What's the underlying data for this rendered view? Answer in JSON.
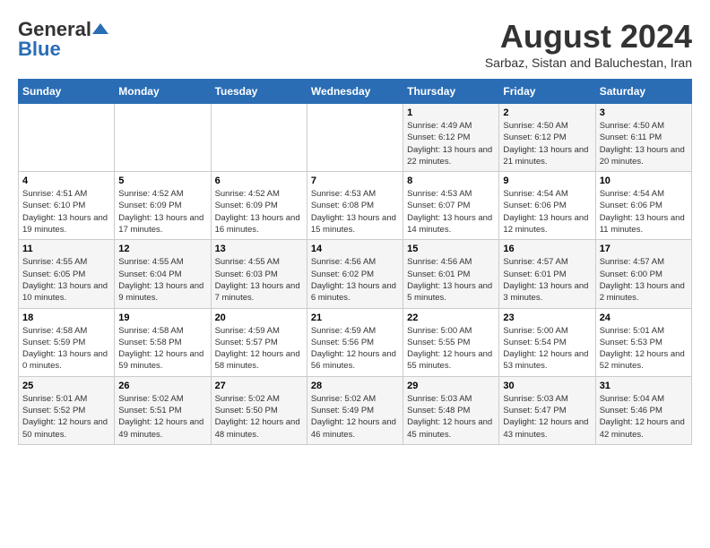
{
  "logo": {
    "general": "General",
    "blue": "Blue"
  },
  "header": {
    "month_year": "August 2024",
    "location": "Sarbaz, Sistan and Baluchestan, Iran"
  },
  "days_of_week": [
    "Sunday",
    "Monday",
    "Tuesday",
    "Wednesday",
    "Thursday",
    "Friday",
    "Saturday"
  ],
  "weeks": [
    [
      {
        "day": "",
        "info": ""
      },
      {
        "day": "",
        "info": ""
      },
      {
        "day": "",
        "info": ""
      },
      {
        "day": "",
        "info": ""
      },
      {
        "day": "1",
        "info": "Sunrise: 4:49 AM\nSunset: 6:12 PM\nDaylight: 13 hours and 22 minutes."
      },
      {
        "day": "2",
        "info": "Sunrise: 4:50 AM\nSunset: 6:12 PM\nDaylight: 13 hours and 21 minutes."
      },
      {
        "day": "3",
        "info": "Sunrise: 4:50 AM\nSunset: 6:11 PM\nDaylight: 13 hours and 20 minutes."
      }
    ],
    [
      {
        "day": "4",
        "info": "Sunrise: 4:51 AM\nSunset: 6:10 PM\nDaylight: 13 hours and 19 minutes."
      },
      {
        "day": "5",
        "info": "Sunrise: 4:52 AM\nSunset: 6:09 PM\nDaylight: 13 hours and 17 minutes."
      },
      {
        "day": "6",
        "info": "Sunrise: 4:52 AM\nSunset: 6:09 PM\nDaylight: 13 hours and 16 minutes."
      },
      {
        "day": "7",
        "info": "Sunrise: 4:53 AM\nSunset: 6:08 PM\nDaylight: 13 hours and 15 minutes."
      },
      {
        "day": "8",
        "info": "Sunrise: 4:53 AM\nSunset: 6:07 PM\nDaylight: 13 hours and 14 minutes."
      },
      {
        "day": "9",
        "info": "Sunrise: 4:54 AM\nSunset: 6:06 PM\nDaylight: 13 hours and 12 minutes."
      },
      {
        "day": "10",
        "info": "Sunrise: 4:54 AM\nSunset: 6:06 PM\nDaylight: 13 hours and 11 minutes."
      }
    ],
    [
      {
        "day": "11",
        "info": "Sunrise: 4:55 AM\nSunset: 6:05 PM\nDaylight: 13 hours and 10 minutes."
      },
      {
        "day": "12",
        "info": "Sunrise: 4:55 AM\nSunset: 6:04 PM\nDaylight: 13 hours and 9 minutes."
      },
      {
        "day": "13",
        "info": "Sunrise: 4:55 AM\nSunset: 6:03 PM\nDaylight: 13 hours and 7 minutes."
      },
      {
        "day": "14",
        "info": "Sunrise: 4:56 AM\nSunset: 6:02 PM\nDaylight: 13 hours and 6 minutes."
      },
      {
        "day": "15",
        "info": "Sunrise: 4:56 AM\nSunset: 6:01 PM\nDaylight: 13 hours and 5 minutes."
      },
      {
        "day": "16",
        "info": "Sunrise: 4:57 AM\nSunset: 6:01 PM\nDaylight: 13 hours and 3 minutes."
      },
      {
        "day": "17",
        "info": "Sunrise: 4:57 AM\nSunset: 6:00 PM\nDaylight: 13 hours and 2 minutes."
      }
    ],
    [
      {
        "day": "18",
        "info": "Sunrise: 4:58 AM\nSunset: 5:59 PM\nDaylight: 13 hours and 0 minutes."
      },
      {
        "day": "19",
        "info": "Sunrise: 4:58 AM\nSunset: 5:58 PM\nDaylight: 12 hours and 59 minutes."
      },
      {
        "day": "20",
        "info": "Sunrise: 4:59 AM\nSunset: 5:57 PM\nDaylight: 12 hours and 58 minutes."
      },
      {
        "day": "21",
        "info": "Sunrise: 4:59 AM\nSunset: 5:56 PM\nDaylight: 12 hours and 56 minutes."
      },
      {
        "day": "22",
        "info": "Sunrise: 5:00 AM\nSunset: 5:55 PM\nDaylight: 12 hours and 55 minutes."
      },
      {
        "day": "23",
        "info": "Sunrise: 5:00 AM\nSunset: 5:54 PM\nDaylight: 12 hours and 53 minutes."
      },
      {
        "day": "24",
        "info": "Sunrise: 5:01 AM\nSunset: 5:53 PM\nDaylight: 12 hours and 52 minutes."
      }
    ],
    [
      {
        "day": "25",
        "info": "Sunrise: 5:01 AM\nSunset: 5:52 PM\nDaylight: 12 hours and 50 minutes."
      },
      {
        "day": "26",
        "info": "Sunrise: 5:02 AM\nSunset: 5:51 PM\nDaylight: 12 hours and 49 minutes."
      },
      {
        "day": "27",
        "info": "Sunrise: 5:02 AM\nSunset: 5:50 PM\nDaylight: 12 hours and 48 minutes."
      },
      {
        "day": "28",
        "info": "Sunrise: 5:02 AM\nSunset: 5:49 PM\nDaylight: 12 hours and 46 minutes."
      },
      {
        "day": "29",
        "info": "Sunrise: 5:03 AM\nSunset: 5:48 PM\nDaylight: 12 hours and 45 minutes."
      },
      {
        "day": "30",
        "info": "Sunrise: 5:03 AM\nSunset: 5:47 PM\nDaylight: 12 hours and 43 minutes."
      },
      {
        "day": "31",
        "info": "Sunrise: 5:04 AM\nSunset: 5:46 PM\nDaylight: 12 hours and 42 minutes."
      }
    ]
  ]
}
